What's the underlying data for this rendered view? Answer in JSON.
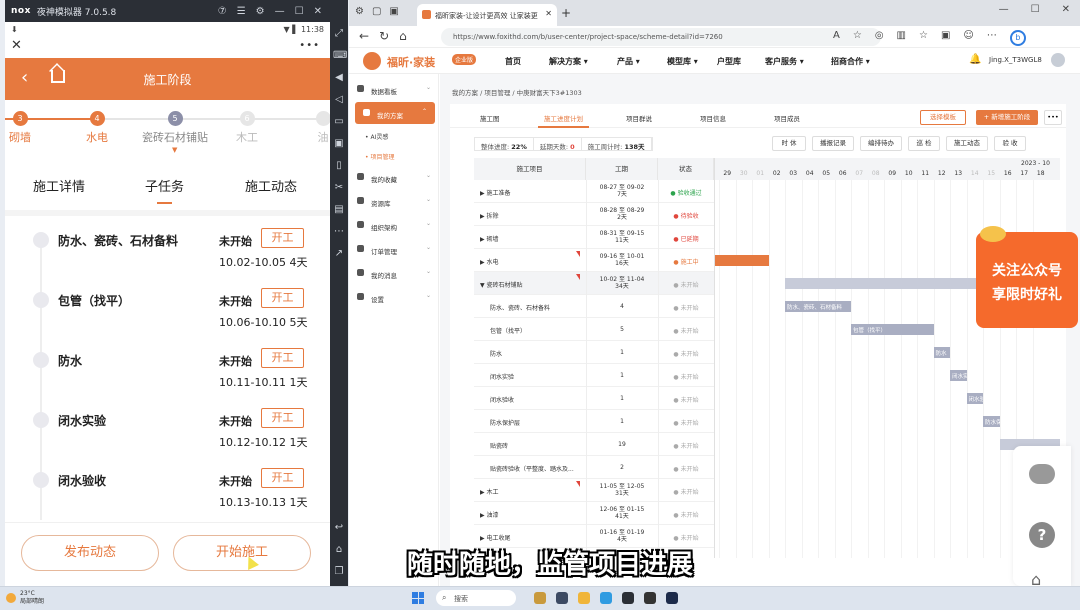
{
  "emulator": {
    "logo": "nox",
    "title": "夜神模拟器 7.0.5.8",
    "controls": [
      "⑦",
      "☰",
      "⚙",
      "—",
      "☐",
      "✕"
    ]
  },
  "phone": {
    "status": {
      "left": "⬇",
      "right": "▼ ▌ 11:38"
    },
    "more_label": "•••",
    "header_title": "施工阶段",
    "steps": [
      {
        "num": "3",
        "label": "砌墙",
        "state": "done"
      },
      {
        "num": "4",
        "label": "水电",
        "state": "done"
      },
      {
        "num": "5",
        "label": "瓷砖石材铺贴",
        "state": "cur"
      },
      {
        "num": "6",
        "label": "木工",
        "state": "todo"
      },
      {
        "num": "",
        "label": "油",
        "state": "todo"
      }
    ],
    "tabs": [
      "施工详情",
      "子任务",
      "施工动态"
    ],
    "active_tab": "子任务",
    "tasks": [
      {
        "name": "防水、瓷砖、石材备料",
        "status": "未开始",
        "button": "开工",
        "dates": "10.02-10.05 4天"
      },
      {
        "name": "包管（找平）",
        "status": "未开始",
        "button": "开工",
        "dates": "10.06-10.10 5天"
      },
      {
        "name": "防水",
        "status": "未开始",
        "button": "开工",
        "dates": "10.11-10.11 1天"
      },
      {
        "name": "闭水实验",
        "status": "未开始",
        "button": "开工",
        "dates": "10.12-10.12 1天"
      },
      {
        "name": "闭水验收",
        "status": "未开始",
        "button": "开工",
        "dates": "10.13-10.13 1天"
      }
    ],
    "bottom": {
      "publish": "发布动态",
      "start": "开始施工"
    },
    "accent": "#e6793f"
  },
  "browser": {
    "tab_title": "福昕家装-让设计更高效 让家装更",
    "url": "https://www.foxithd.com/b/user-center/project-space/scheme-detail?id=7260"
  },
  "site": {
    "logo": "福昕·家装",
    "badge": "企业版",
    "menu": [
      "首页",
      "解决方案 ▾",
      "产品 ▾",
      "模型库 ▾",
      "户型库",
      "客户服务 ▾",
      "招商合作 ▾"
    ],
    "user": "Jing.X_T3WGL8",
    "sidebar": [
      {
        "label": "数据看板",
        "active": false
      },
      {
        "label": "我的方案",
        "active": true
      },
      {
        "label": "我的收藏",
        "active": false
      },
      {
        "label": "资源库",
        "active": false
      },
      {
        "label": "组织架构",
        "active": false
      },
      {
        "label": "订单管理",
        "active": false
      },
      {
        "label": "我的消息",
        "active": false
      },
      {
        "label": "设置",
        "active": false
      }
    ],
    "sidebar_sub": [
      "• AI灵感",
      "• 项目管理"
    ],
    "breadcrumb": "我的方案 / 项目管理 / 中庚财富天下3#1303",
    "sub_tabs": [
      "施工图",
      "施工进度计划",
      "项目群说",
      "项目信息",
      "项目成员"
    ],
    "active_sub_tab": "施工进度计划",
    "select_template": "选择模板",
    "new_stage": "+ 新增施工阶段",
    "more": "•••",
    "stats": {
      "overall_label": "整体进度:",
      "overall": "22%",
      "delay_label": "延期天数:",
      "delay": "0",
      "days_label": "施工周计时:",
      "days": "138天"
    },
    "actions": [
      "时 休",
      "播报记录",
      "编排待办",
      "巡 检",
      "施工动态",
      "验 收"
    ],
    "columns": [
      "施工项目",
      "工期",
      "状态"
    ],
    "rows": [
      {
        "name": "▶ 施工准备",
        "period": "08-27 至 09-02\n7天",
        "status": "● 验收通过",
        "cls": "st-green"
      },
      {
        "name": "▶ 拆除",
        "period": "08-28 至 08-29\n2天",
        "status": "● 待验收",
        "cls": "st-red"
      },
      {
        "name": "▶ 砌墙",
        "period": "08-31 至 09-15\n11天",
        "status": "● 已延期",
        "cls": "st-red"
      },
      {
        "name": "▶ 水电",
        "period": "09-16 至 10-01\n16天",
        "status": "● 施工中",
        "cls": "st-orange"
      },
      {
        "name": "▼ 瓷砖石材铺贴",
        "period": "10-02 至 11-04\n34天",
        "status": "● 未开始",
        "cls": "st-gray"
      },
      {
        "name": "防水、瓷砖、石材备料",
        "period": "4",
        "status": "● 未开始",
        "cls": "st-gray",
        "child": true
      },
      {
        "name": "包管（找平）",
        "period": "5",
        "status": "● 未开始",
        "cls": "st-gray",
        "child": true
      },
      {
        "name": "防水",
        "period": "1",
        "status": "● 未开始",
        "cls": "st-gray",
        "child": true
      },
      {
        "name": "闭水实验",
        "period": "1",
        "status": "● 未开始",
        "cls": "st-gray",
        "child": true
      },
      {
        "name": "闭水验收",
        "period": "1",
        "status": "● 未开始",
        "cls": "st-gray",
        "child": true
      },
      {
        "name": "防水保护层",
        "period": "1",
        "status": "● 未开始",
        "cls": "st-gray",
        "child": true
      },
      {
        "name": "贴瓷砖",
        "period": "19",
        "status": "● 未开始",
        "cls": "st-gray",
        "child": true
      },
      {
        "name": "贴瓷砖验收（平整度、踏水及...",
        "period": "2",
        "status": "● 未开始",
        "cls": "st-gray",
        "child": true
      },
      {
        "name": "▶ 木工",
        "period": "11-05 至 12-05\n31天",
        "status": "● 未开始",
        "cls": "st-gray"
      },
      {
        "name": "▶ 油漆",
        "period": "12-06 至 01-15\n41天",
        "status": "● 未开始",
        "cls": "st-gray"
      },
      {
        "name": "▶ 电工收尾",
        "period": "01-16 至 01-19\n4天",
        "status": "● 未开始",
        "cls": "st-gray"
      }
    ],
    "gantt": {
      "month": "2023 - 10",
      "days": [
        "29",
        "30",
        "01",
        "02",
        "03",
        "04",
        "05",
        "06",
        "07",
        "08",
        "09",
        "10",
        "11",
        "12",
        "13",
        "14",
        "15",
        "16",
        "17",
        "18"
      ],
      "weekend": [
        "30",
        "01",
        "07",
        "08",
        "14",
        "15"
      ],
      "bar_labels": {
        "r5": "防水、瓷砖、石材备料",
        "r6": "包管（找平）",
        "r7": "防水",
        "r8": "闭水实验",
        "r9": "闭水验收",
        "r10": "防水保护层"
      }
    },
    "promo": {
      "line1": "关注公众号",
      "line2": "享限时好礼"
    },
    "help": "?"
  },
  "subtitle": "随时随地，监管项目进展",
  "taskbar": {
    "weather_temp": "23°C",
    "weather_desc": "局部晴朗",
    "search": "搜索"
  }
}
